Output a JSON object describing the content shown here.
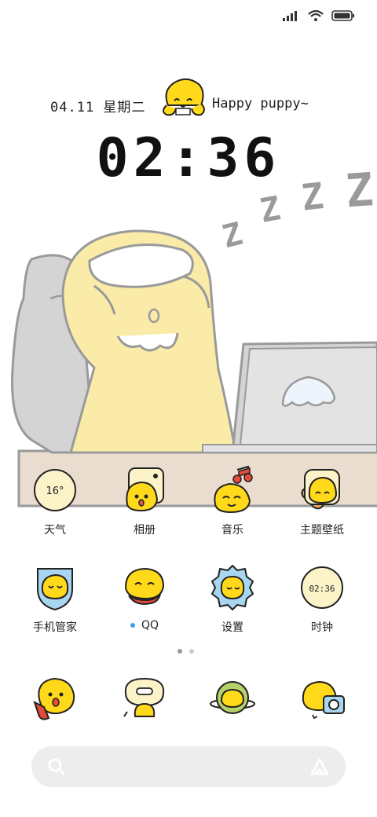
{
  "status_bar": {
    "signal_icon": "cellular-signal-icon",
    "wifi_icon": "wifi-icon",
    "battery_icon": "battery-icon"
  },
  "lockscreen": {
    "date": "04.11 星期二",
    "tagline": "Happy puppy~",
    "time": "02:36",
    "sleep_text": "Z Z Z Z"
  },
  "apps_row1": [
    {
      "label": "天气",
      "badge": "16°"
    },
    {
      "label": "相册"
    },
    {
      "label": "音乐"
    },
    {
      "label": "主题壁纸"
    }
  ],
  "apps_row2": [
    {
      "label": "手机管家"
    },
    {
      "label": "QQ"
    },
    {
      "label": "设置"
    },
    {
      "label": "时钟",
      "badge": "02:36"
    }
  ],
  "dock_icons": [
    "phone-icon",
    "messages-icon",
    "browser-icon",
    "camera-icon"
  ],
  "colors": {
    "yellow": "#FFD91A",
    "body_yellow": "#FBEBA8",
    "gray": "#D4D4D4",
    "desk": "#EADDD0",
    "accent_blue": "#3AA0E8"
  }
}
